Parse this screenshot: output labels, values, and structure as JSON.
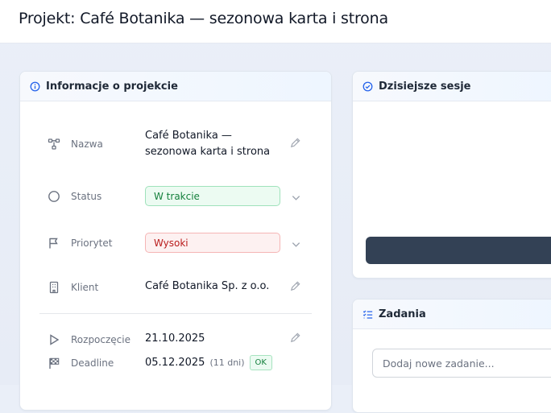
{
  "page": {
    "title": "Projekt: Café Botanika — sezonowa karta i strona"
  },
  "info": {
    "title": "Informacje o projekcie",
    "name": {
      "label": "Nazwa",
      "value_line1": "Café Botanika —",
      "value_line2": "sezonowa karta i strona"
    },
    "status": {
      "label": "Status",
      "value": "W trakcie"
    },
    "priority": {
      "label": "Priorytet",
      "value": "Wysoki"
    },
    "client": {
      "label": "Klient",
      "value": "Café Botanika Sp. z o.o."
    },
    "start": {
      "label": "Rozpoczęcie",
      "value": "21.10.2025"
    },
    "deadline": {
      "label": "Deadline",
      "value": "05.12.2025",
      "remaining": "(11 dni)",
      "badge": "OK"
    }
  },
  "sessions": {
    "title": "Dzisiejsze sesje"
  },
  "tasks": {
    "title": "Zadania",
    "input_placeholder": "Dodaj nowe zadanie..."
  },
  "colors": {
    "accent": "#2563eb",
    "status_green": "#15803d",
    "priority_red": "#b91c1c",
    "dark_button": "#334155"
  },
  "icons": {
    "info_header": "info-circle-icon",
    "sessions_header": "check-circle-icon",
    "tasks_header": "list-check-icon",
    "name": "hierarchy-icon",
    "status": "circle-icon",
    "priority": "flag-icon",
    "client": "building-icon",
    "start": "play-icon",
    "deadline": "finish-flag-icon",
    "edit": "pencil-icon",
    "dropdown": "chevron-down-icon"
  }
}
